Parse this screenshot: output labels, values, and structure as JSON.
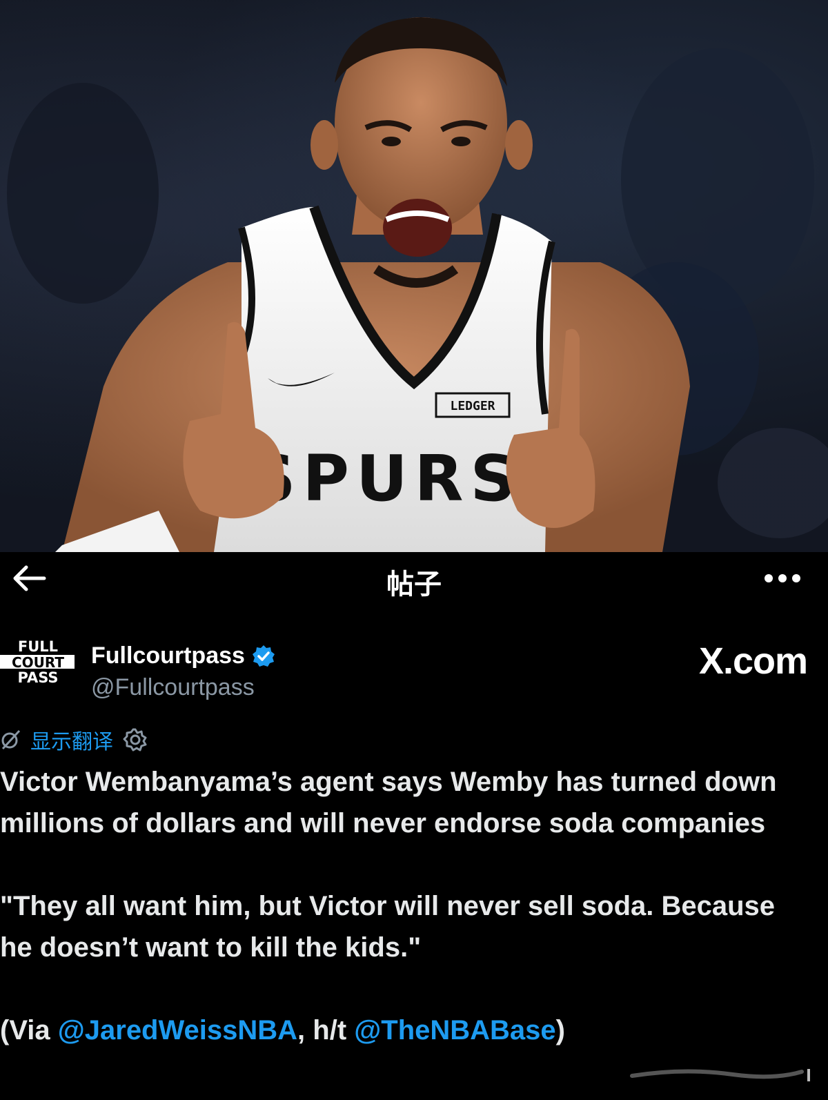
{
  "nav": {
    "title": "帖子",
    "back_icon": "arrow-left-icon",
    "more_icon": "more-horizontal-icon"
  },
  "photo": {
    "jersey_team": "SPURS",
    "jersey_sponsor": "LEDGER"
  },
  "author": {
    "avatar_logo": [
      "FULL",
      "COURT",
      "PASS"
    ],
    "name": "Fullcourtpass",
    "verified": true,
    "handle": "@Fullcourtpass",
    "site_label": "X.com"
  },
  "translate": {
    "label": "显示翻译"
  },
  "tweet": {
    "paragraph1": "Victor Wembanyama’s agent says Wemby has turned down millions of dollars and will never endorse soda companies",
    "paragraph2": "\"They all want him, but Victor will never sell soda. Because he doesn’t want to kill the kids.\"",
    "via_prefix": "(Via ",
    "mention1": "@JaredWeissNBA",
    "middle": ", h/t ",
    "mention2": "@TheNBABase",
    "suffix": ")"
  },
  "colors": {
    "background": "#000000",
    "text": "#e7e9ea",
    "secondary": "#8b98a5",
    "link": "#1d9bf0",
    "jersey": "#f3f3f3"
  }
}
